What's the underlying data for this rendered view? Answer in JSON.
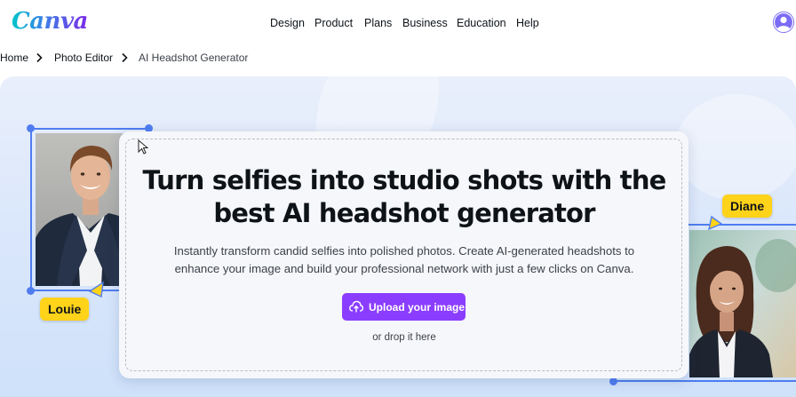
{
  "header": {
    "logo_text": "Canva",
    "nav": [
      {
        "label": "Design"
      },
      {
        "label": "Product"
      },
      {
        "label": "Plans"
      },
      {
        "label": "Business"
      },
      {
        "label": "Education"
      },
      {
        "label": "Help"
      }
    ],
    "avatar_icon": "user-avatar-icon"
  },
  "breadcrumb": {
    "items": [
      {
        "label": "Home"
      },
      {
        "label": "Photo Editor"
      },
      {
        "label": "AI Headshot Generator"
      }
    ],
    "separator_icon": "chevron-right-icon"
  },
  "hero": {
    "headline_line1": "Turn selfies into studio shots with the",
    "headline_line2": "best AI headshot generator",
    "description_line1": "Instantly transform candid selfies into polished photos. Create AI-generated headshots to",
    "description_line2": "enhance your image and build your professional network with just a few clicks on Canva.",
    "upload_button_label": "Upload your image",
    "upload_icon": "cloud-upload-icon",
    "drop_hint": "or drop it here",
    "left_tag": "Louie",
    "right_tag": "Diane"
  },
  "colors": {
    "accent": "#8b3dff",
    "selection": "#4f7df0",
    "tag": "#ffd31a",
    "hero_bg": "#dbe7fb"
  }
}
